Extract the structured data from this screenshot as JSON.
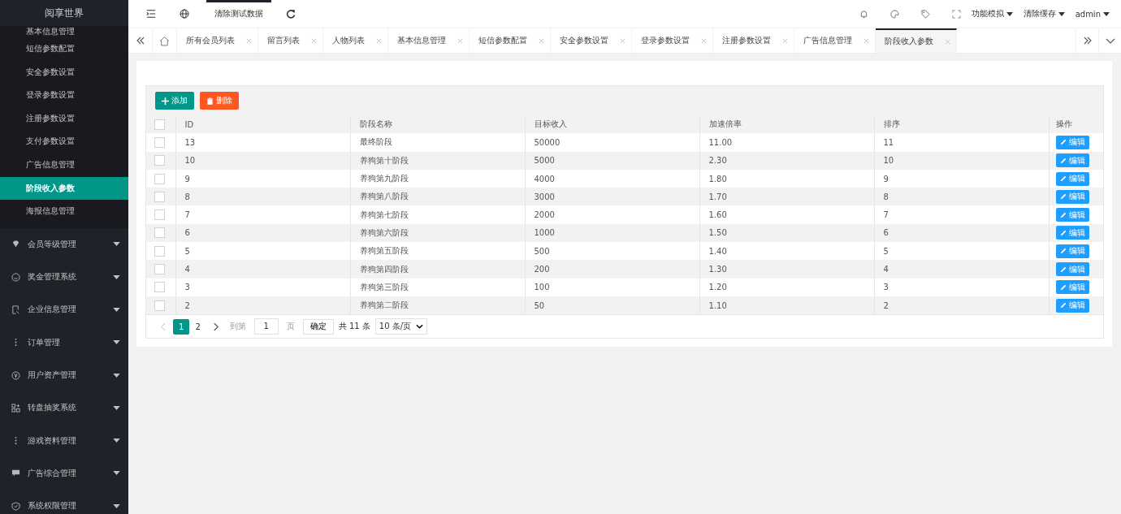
{
  "sidebar": {
    "logo": "阅享世界",
    "sub_items": [
      {
        "label": "基本信息管理",
        "selected": false
      },
      {
        "label": "短信参数配置",
        "selected": false
      },
      {
        "label": "安全参数设置",
        "selected": false
      },
      {
        "label": "登录参数设置",
        "selected": false
      },
      {
        "label": "注册参数设置",
        "selected": false
      },
      {
        "label": "支付参数设置",
        "selected": false
      },
      {
        "label": "广告信息管理",
        "selected": false
      },
      {
        "label": "阶段收入参数",
        "selected": true
      },
      {
        "label": "海报信息管理",
        "selected": false
      }
    ],
    "groups": [
      {
        "label": "会员等级管理",
        "kind": "diamond",
        "expanded": false
      },
      {
        "label": "奖金管理系统",
        "kind": "smile",
        "expanded": false
      },
      {
        "label": "企业信息管理",
        "kind": "doc",
        "expanded": false
      },
      {
        "label": "订单管理",
        "kind": "dots",
        "expanded": false
      },
      {
        "label": "用户资产管理",
        "kind": "yen",
        "expanded": false
      },
      {
        "label": "转盘抽奖系统",
        "kind": "apps",
        "expanded": false
      },
      {
        "label": "游戏资料管理",
        "kind": "dots",
        "expanded": false
      },
      {
        "label": "广告综合管理",
        "kind": "chat",
        "expanded": false
      },
      {
        "label": "系统权限管理",
        "kind": "shield",
        "expanded": false
      }
    ]
  },
  "header": {
    "clear_test_data": {
      "label": "清除测试数据",
      "selected": true
    },
    "menus": [
      "功能模拟",
      "清除缓存",
      "admin"
    ]
  },
  "tabs": [
    {
      "label": "所有会员列表",
      "selected": false
    },
    {
      "label": "留言列表",
      "selected": false
    },
    {
      "label": "人物列表",
      "selected": false
    },
    {
      "label": "基本信息管理",
      "selected": false
    },
    {
      "label": "短信参数配置",
      "selected": false
    },
    {
      "label": "安全参数设置",
      "selected": false
    },
    {
      "label": "登录参数设置",
      "selected": false
    },
    {
      "label": "注册参数设置",
      "selected": false
    },
    {
      "label": "广告信息管理",
      "selected": false
    },
    {
      "label": "阶段收入参数",
      "selected": true
    }
  ],
  "toolbar": {
    "add": "添加",
    "delete": "删除"
  },
  "table": {
    "select_all_checked": false,
    "columns": [
      "ID",
      "阶段名称",
      "目标收入",
      "加速倍率",
      "排序",
      "操作"
    ],
    "rows": [
      {
        "checked": false,
        "cells": [
          "13",
          "最终阶段",
          "50000",
          "11.00",
          "11"
        ],
        "action": "编辑"
      },
      {
        "checked": false,
        "cells": [
          "10",
          "养狗第十阶段",
          "5000",
          "2.30",
          "10"
        ],
        "action": "编辑"
      },
      {
        "checked": false,
        "cells": [
          "9",
          "养狗第九阶段",
          "4000",
          "1.80",
          "9"
        ],
        "action": "编辑"
      },
      {
        "checked": false,
        "cells": [
          "8",
          "养狗第八阶段",
          "3000",
          "1.70",
          "8"
        ],
        "action": "编辑"
      },
      {
        "checked": false,
        "cells": [
          "7",
          "养狗第七阶段",
          "2000",
          "1.60",
          "7"
        ],
        "action": "编辑"
      },
      {
        "checked": false,
        "cells": [
          "6",
          "养狗第六阶段",
          "1000",
          "1.50",
          "6"
        ],
        "action": "编辑"
      },
      {
        "checked": false,
        "cells": [
          "5",
          "养狗第五阶段",
          "500",
          "1.40",
          "5"
        ],
        "action": "编辑"
      },
      {
        "checked": false,
        "cells": [
          "4",
          "养狗第四阶段",
          "200",
          "1.30",
          "4"
        ],
        "action": "编辑"
      },
      {
        "checked": false,
        "cells": [
          "3",
          "养狗第三阶段",
          "100",
          "1.20",
          "3"
        ],
        "action": "编辑"
      },
      {
        "checked": false,
        "cells": [
          "2",
          "养狗第二阶段",
          "50",
          "1.10",
          "2"
        ],
        "action": "编辑"
      }
    ]
  },
  "pagination": {
    "pages": [
      {
        "label": "1",
        "selected": true
      },
      {
        "label": "2",
        "selected": false
      }
    ],
    "goto_prefix": "到第",
    "goto_value": "1",
    "goto_suffix": "页",
    "confirm": "确定",
    "total": "共 11 条",
    "page_size": "10 条/页"
  }
}
